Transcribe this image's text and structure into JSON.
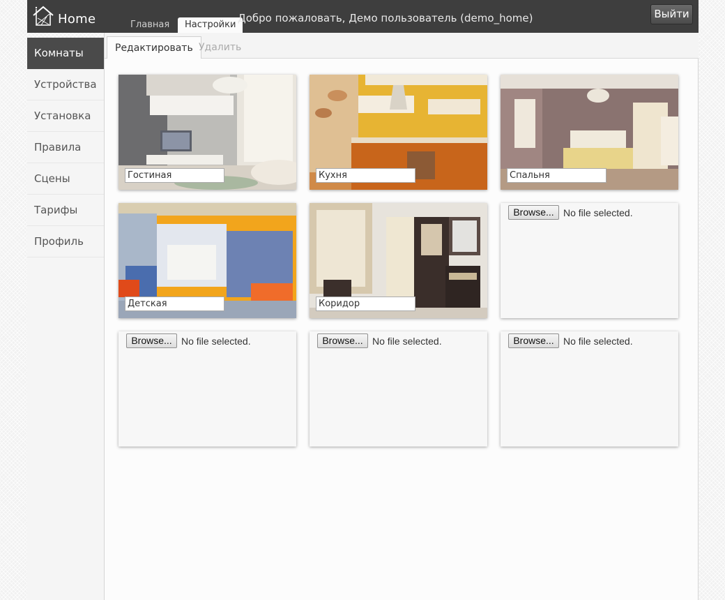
{
  "header": {
    "logo_text": "Home",
    "welcome": "Добро пожаловать, Демо пользователь (demo_home)",
    "logout_label": "Выйти",
    "tabs": [
      {
        "label": "Главная",
        "active": false
      },
      {
        "label": "Настройки",
        "active": true
      }
    ]
  },
  "sidebar": {
    "items": [
      {
        "label": "Комнаты",
        "active": true
      },
      {
        "label": "Устройства"
      },
      {
        "label": "Установка"
      },
      {
        "label": "Правила"
      },
      {
        "label": "Сцены"
      },
      {
        "label": "Тарифы"
      },
      {
        "label": "Профиль"
      }
    ]
  },
  "main": {
    "subtabs": [
      {
        "label": "Редактировать",
        "active": true
      },
      {
        "label": "Удалить",
        "active": false
      }
    ],
    "rooms": [
      {
        "name": "Гостиная",
        "photo": "living-room"
      },
      {
        "name": "Кухня",
        "photo": "kitchen"
      },
      {
        "name": "Спальня",
        "photo": "bedroom"
      },
      {
        "name": "Детская",
        "photo": "kids-room"
      },
      {
        "name": "Коридор",
        "photo": "hallway"
      }
    ],
    "empty_slots": [
      {
        "browse_label": "Browse...",
        "status": "No file selected."
      },
      {
        "browse_label": "Browse...",
        "status": "No file selected."
      },
      {
        "browse_label": "Browse...",
        "status": "No file selected."
      },
      {
        "browse_label": "Browse...",
        "status": "No file selected."
      }
    ]
  },
  "colors": {
    "header_bg": "#3e3e3e",
    "sidebar_active_bg": "#4a4a4a",
    "main_bg": "#fcfcfc"
  }
}
